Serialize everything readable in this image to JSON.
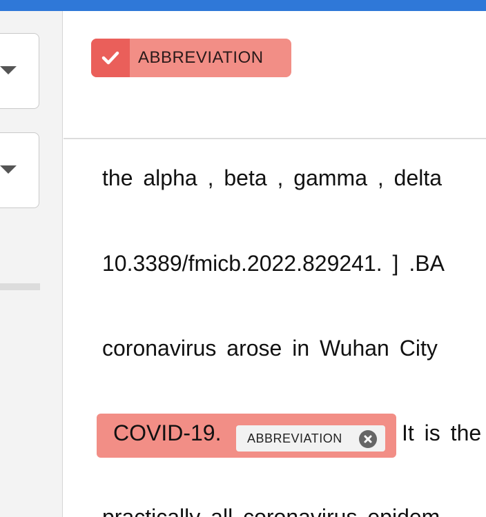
{
  "colors": {
    "topbar": "#2f78d8",
    "label_bg": "#f28e86",
    "label_check_bg": "#ea5f5a"
  },
  "left_panel": {
    "dropdowns": [
      "",
      ""
    ]
  },
  "label_chip": {
    "text": "ABBREVIATION",
    "icon": "check-icon"
  },
  "document": {
    "lines": [
      "the alpha , beta , gamma , delta",
      "10.3389/fmicb.2022.829241. ] .BA",
      "coronavirus arose in Wuhan City"
    ],
    "highlight": {
      "text": "COVID-19.",
      "tag": "ABBREVIATION",
      "remove_icon": "close-circle-icon"
    },
    "after_highlight": "It is the",
    "last_line_partial": "practically all coronavirus epidem"
  }
}
